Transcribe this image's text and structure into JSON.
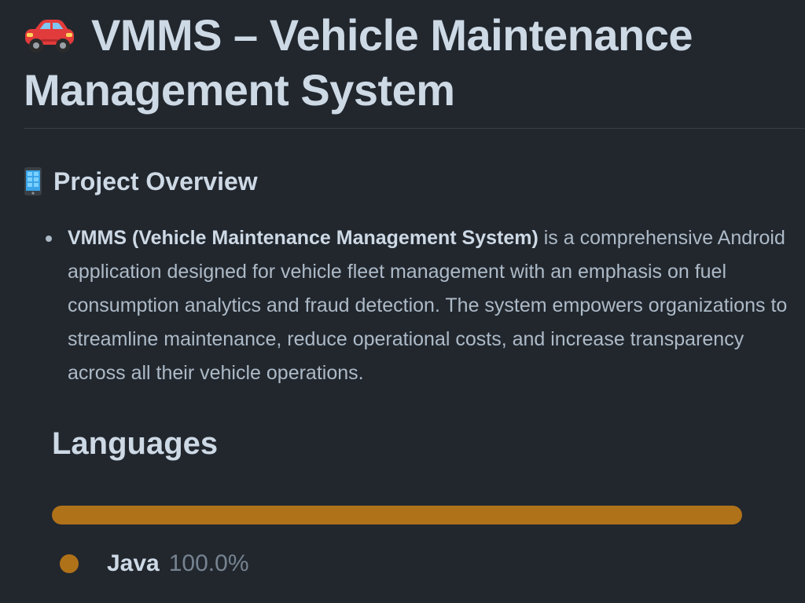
{
  "header": {
    "emoji": "car-icon",
    "title": "VMMS – Vehicle Maintenance Management System"
  },
  "overview": {
    "icon": "mobile-phone-icon",
    "heading": "Project Overview",
    "bullet_strong": "VMMS (Vehicle Maintenance Management System)",
    "bullet_text": " is a comprehensive Android application designed for vehicle fleet management with an emphasis on fuel consumption analytics and fraud detection. The system empowers organizations to streamline maintenance, reduce operational costs, and increase transparency across all their vehicle operations."
  },
  "languages": {
    "heading": "Languages",
    "items": [
      {
        "name": "Java",
        "percent_label": "100.0%",
        "percent": 100,
        "color": "#b07219"
      }
    ]
  },
  "colors": {
    "background": "#22272e",
    "heading_text": "#cdd9e5",
    "body_text": "#adbac7",
    "muted_text": "#768390",
    "java": "#b07219"
  }
}
